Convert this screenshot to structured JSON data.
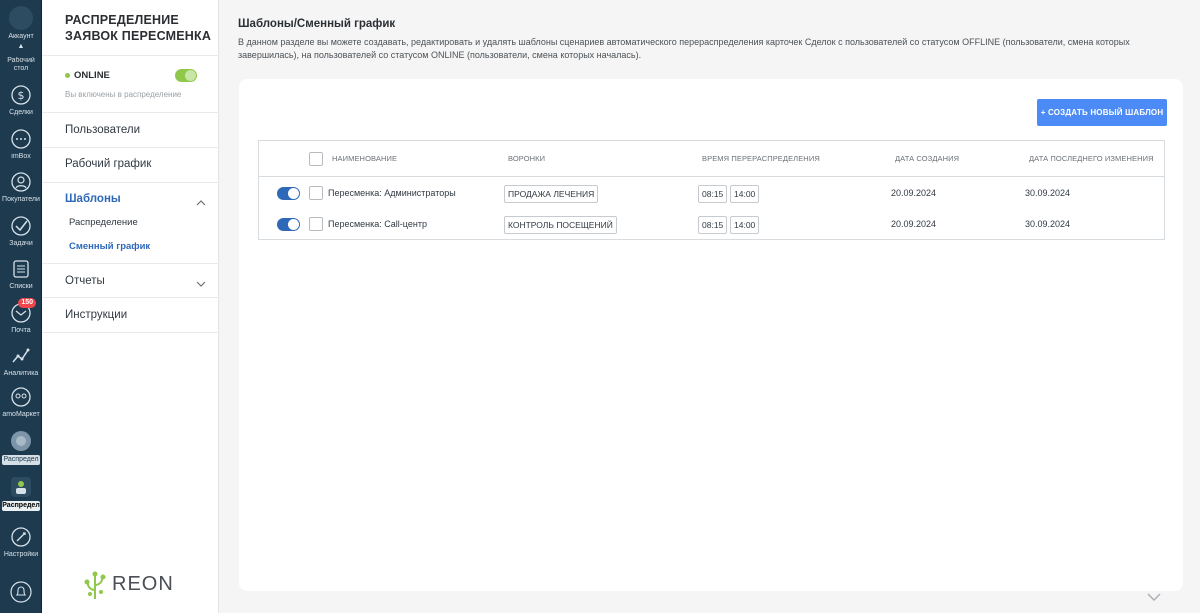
{
  "nav": {
    "items": [
      {
        "label": "Аккаунт",
        "icon": "account-icon"
      },
      {
        "label": "Рабочий стол",
        "icon": "dashboard-icon"
      },
      {
        "label": "Сделки",
        "icon": "deals-icon"
      },
      {
        "label": "imBox",
        "icon": "chat-icon"
      },
      {
        "label": "Покупатели",
        "icon": "customers-icon"
      },
      {
        "label": "Задачи",
        "icon": "tasks-icon"
      },
      {
        "label": "Списки",
        "icon": "lists-icon"
      },
      {
        "label": "Почта",
        "icon": "mail-icon",
        "badge": "150"
      },
      {
        "label": "Аналитика",
        "icon": "analytics-icon"
      },
      {
        "label": "amoМаркет",
        "icon": "market-icon"
      },
      {
        "label": "Распредел",
        "icon": "distribution-icon"
      },
      {
        "label": "Распредел",
        "icon": "reshift-icon"
      },
      {
        "label": "Настройки",
        "icon": "settings-icon"
      }
    ]
  },
  "sidebar": {
    "title": "РАСПРЕДЕЛЕНИЕ ЗАЯВОК ПЕРЕСМЕНКА",
    "status": "ONLINE",
    "status_sub": "Вы включены в распределение",
    "items": [
      {
        "label": "Пользователи"
      },
      {
        "label": "Рабочий график"
      },
      {
        "label": "Шаблоны"
      },
      {
        "label": "Отчеты"
      },
      {
        "label": "Инструкции"
      }
    ],
    "sub_items": [
      {
        "label": "Распределение"
      },
      {
        "label": "Сменный график"
      }
    ],
    "logo": "REON"
  },
  "main": {
    "title": "Шаблоны/Сменный график",
    "description": "В данном разделе вы можете создавать, редактировать и удалять шаблоны сценариев автоматического перераспределения карточек Сделок с пользователей со статусом OFFLINE (пользователи, смена которых завершилась), на пользователей со статусом ONLINE (пользователи, смена которых началась).",
    "create_button": "+ СОЗДАТЬ НОВЫЙ ШАБЛОН"
  },
  "table": {
    "columns": [
      "НАИМЕНОВАНИЕ",
      "ВОРОНКИ",
      "ВРЕМЯ ПЕРЕРАСПРЕДЕЛЕНИЯ",
      "ДАТА СОЗДАНИЯ",
      "ДАТА ПОСЛЕДНЕГО ИЗМЕНЕНИЯ"
    ],
    "rows": [
      {
        "name": "Пересменка: Администраторы",
        "funnel": "ПРОДАЖА ЛЕЧЕНИЯ",
        "time_from": "08:15",
        "time_to": "14:00",
        "created": "20.09.2024",
        "modified": "30.09.2024",
        "enabled": true
      },
      {
        "name": "Пересменка: Call-центр",
        "funnel": "КОНТРОЛЬ ПОСЕЩЕНИЙ",
        "time_from": "08:15",
        "time_to": "14:00",
        "created": "20.09.2024",
        "modified": "30.09.2024",
        "enabled": true
      }
    ]
  },
  "colors": {
    "nav_bg": "#1e3a4f",
    "accent": "#2e68b8",
    "button": "#4c8bf5",
    "online": "#8fc84a",
    "badge": "#f0464e"
  }
}
